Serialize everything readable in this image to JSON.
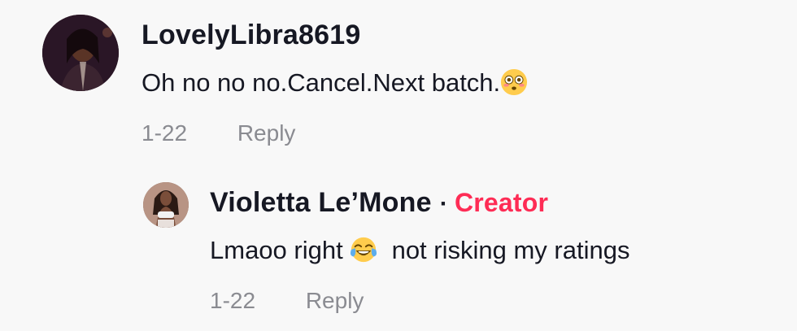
{
  "comments": [
    {
      "username": "LovelyLibra8619",
      "text": "Oh no no no.Cancel.Next batch.",
      "emoji": "flushed-face-emoji",
      "date": "1-22",
      "reply_label": "Reply"
    },
    {
      "username": "Violetta Le’Mone",
      "separator": "·",
      "badge": "Creator",
      "text_before": "Lmaoo right",
      "emoji": "face-with-tears-of-joy-emoji",
      "text_after": "not risking my ratings",
      "date": "1-22",
      "reply_label": "Reply"
    }
  ],
  "colors": {
    "text": "#161823",
    "muted": "#8a8b91",
    "creator": "#fe2c55",
    "background": "#f8f8f8"
  }
}
